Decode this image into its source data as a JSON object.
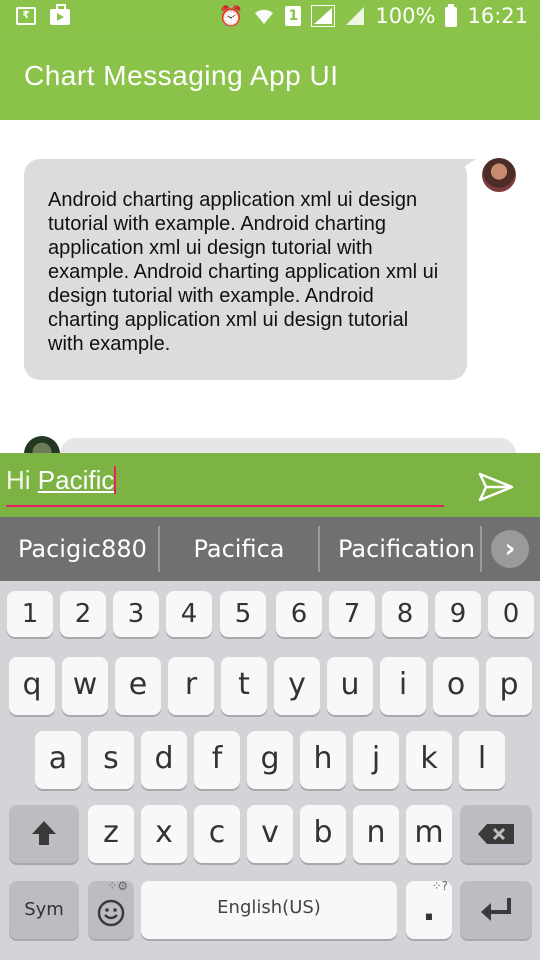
{
  "status_bar": {
    "battery": "100%",
    "time": "16:21",
    "left_icons": [
      "rs-icon",
      "bag-icon"
    ],
    "right_icons": [
      "alarm-icon",
      "wifi-icon",
      "sim1-icon",
      "signal-icon",
      "signal2-icon",
      "battery-icon"
    ]
  },
  "app_bar": {
    "title": "Chart Messaging App UI"
  },
  "chat": {
    "messages": [
      {
        "text": "Android charting application xml ui design tutorial with example. Android charting application xml ui design tutorial with example. Android charting application xml ui design tutorial with example. Android charting application xml ui design tutorial with example."
      }
    ]
  },
  "compose": {
    "prefix": "Hi ",
    "current_word": "Pacific"
  },
  "suggestions": [
    "Pacigic880",
    "Pacifica",
    "Pacification"
  ],
  "keyboard": {
    "row_numbers": [
      "1",
      "2",
      "3",
      "4",
      "5",
      "6",
      "7",
      "8",
      "9",
      "0"
    ],
    "row1": [
      "q",
      "w",
      "e",
      "r",
      "t",
      "y",
      "u",
      "i",
      "o",
      "p"
    ],
    "row2": [
      "a",
      "s",
      "d",
      "f",
      "g",
      "h",
      "j",
      "k",
      "l"
    ],
    "row3": [
      "z",
      "x",
      "c",
      "v",
      "b",
      "n",
      "m"
    ],
    "sym_label": "Sym",
    "space_label": "English(US)",
    "period_label": "."
  },
  "colors": {
    "app_bar": "#8bc34a",
    "compose_bar": "#7cb342",
    "accent": "#e91e63",
    "bubble": "#dcdcdc"
  }
}
